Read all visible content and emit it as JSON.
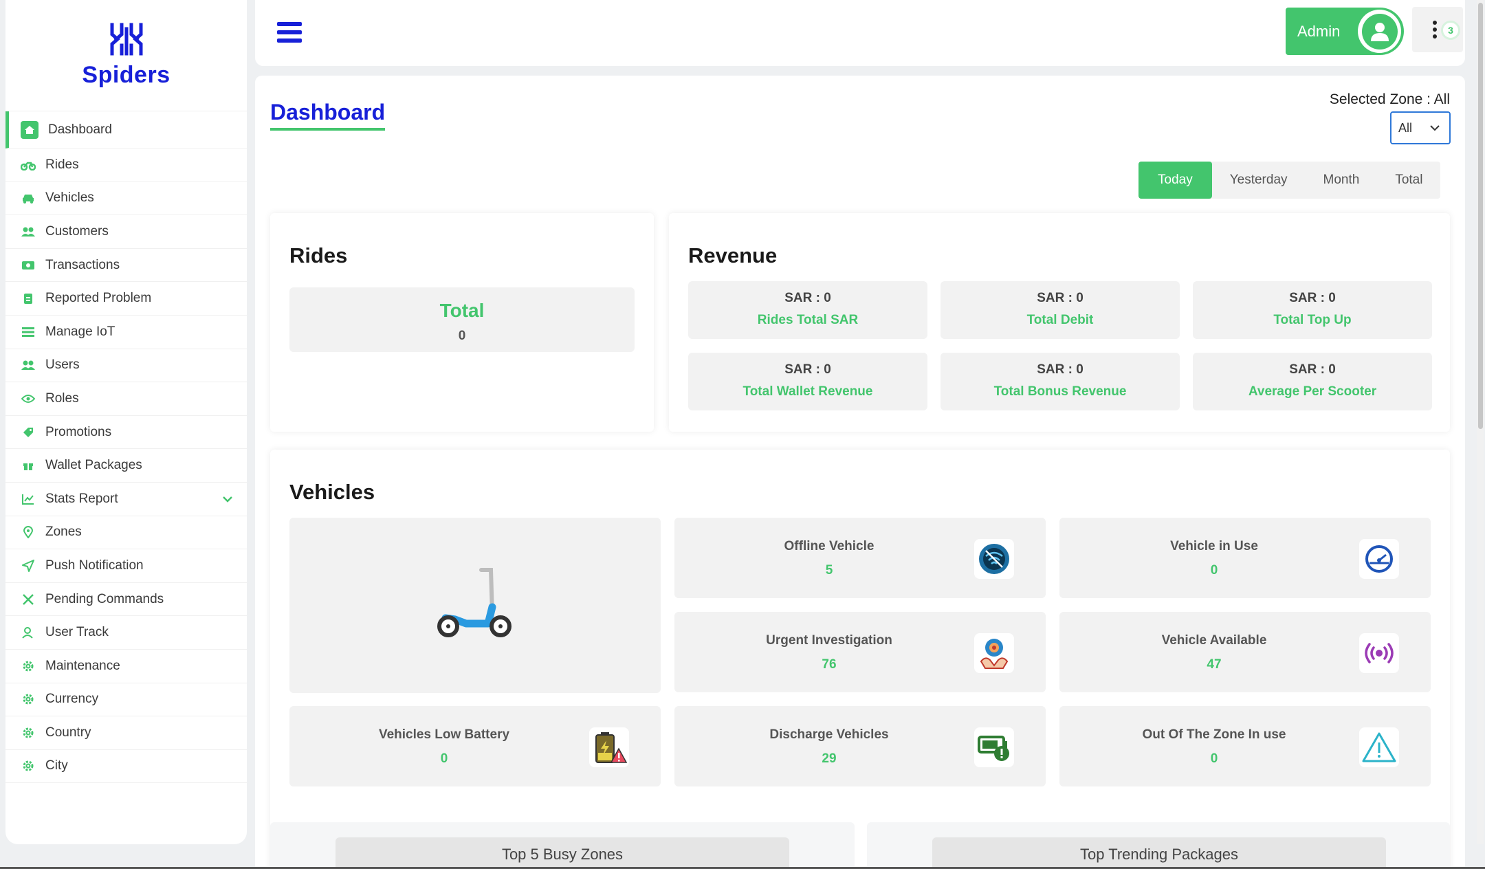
{
  "brand": {
    "name": "Spiders",
    "color": "#1720d8"
  },
  "colors": {
    "accent": "#43c56d",
    "brand": "#1720d8"
  },
  "sidebar": {
    "items": [
      {
        "label": "Dashboard",
        "icon": "home-icon",
        "active": true
      },
      {
        "label": "Rides",
        "icon": "motorbike-icon"
      },
      {
        "label": "Vehicles",
        "icon": "car-icon"
      },
      {
        "label": "Customers",
        "icon": "users-icon"
      },
      {
        "label": "Transactions",
        "icon": "money-icon"
      },
      {
        "label": "Reported Problem",
        "icon": "clipboard-icon"
      },
      {
        "label": "Manage IoT",
        "icon": "list-icon"
      },
      {
        "label": "Users",
        "icon": "users-icon"
      },
      {
        "label": "Roles",
        "icon": "eye-icon"
      },
      {
        "label": "Promotions",
        "icon": "tag-icon"
      },
      {
        "label": "Wallet Packages",
        "icon": "gift-icon"
      },
      {
        "label": "Stats Report",
        "icon": "chart-line-icon",
        "expandable": true
      },
      {
        "label": "Zones",
        "icon": "map-pin-icon"
      },
      {
        "label": "Push Notification",
        "icon": "send-icon"
      },
      {
        "label": "Pending Commands",
        "icon": "tools-icon"
      },
      {
        "label": "User Track",
        "icon": "user-icon"
      },
      {
        "label": "Maintenance",
        "icon": "gear-icon"
      },
      {
        "label": "Currency",
        "icon": "gear-icon"
      },
      {
        "label": "Country",
        "icon": "gear-icon"
      },
      {
        "label": "City",
        "icon": "gear-icon"
      }
    ]
  },
  "header": {
    "admin_label": "Admin",
    "notification_count": "3"
  },
  "main": {
    "title": "Dashboard",
    "zone_label": "Selected Zone : All",
    "zone_select_value": "All",
    "period_tabs": [
      {
        "label": "Today",
        "active": true
      },
      {
        "label": "Yesterday"
      },
      {
        "label": "Month"
      },
      {
        "label": "Total"
      }
    ]
  },
  "rides": {
    "title": "Rides",
    "total_label": "Total",
    "total_value": "0"
  },
  "revenue": {
    "title": "Revenue",
    "items": [
      {
        "amount": "SAR : 0",
        "label": "Rides Total SAR"
      },
      {
        "amount": "SAR : 0",
        "label": "Total Debit"
      },
      {
        "amount": "SAR : 0",
        "label": "Total Top Up"
      },
      {
        "amount": "SAR : 0",
        "label": "Total Wallet Revenue"
      },
      {
        "amount": "SAR : 0",
        "label": "Total Bonus Revenue"
      },
      {
        "amount": "SAR : 0",
        "label": "Average Per Scooter"
      }
    ]
  },
  "vehicles": {
    "title": "Vehicles",
    "image_icon": "scooter-icon",
    "items": [
      {
        "label": "Offline Vehicle",
        "value": "5",
        "icon": "globe-offline-icon"
      },
      {
        "label": "Vehicle in Use",
        "value": "0",
        "icon": "speedometer-icon"
      },
      {
        "label": "Urgent Investigation",
        "value": "76",
        "icon": "investigation-icon"
      },
      {
        "label": "Vehicle Available",
        "value": "47",
        "icon": "signal-icon"
      },
      {
        "label": "Vehicles Low Battery",
        "value": "0",
        "icon": "low-battery-icon"
      },
      {
        "label": "Discharge Vehicles",
        "value": "29",
        "icon": "battery-alert-icon"
      },
      {
        "label": "Out Of The Zone In use",
        "value": "0",
        "icon": "warning-icon"
      }
    ]
  },
  "bottom": {
    "busy_zones_title": "Top 5 Busy Zones",
    "trending_packages_title": "Top Trending Packages"
  }
}
